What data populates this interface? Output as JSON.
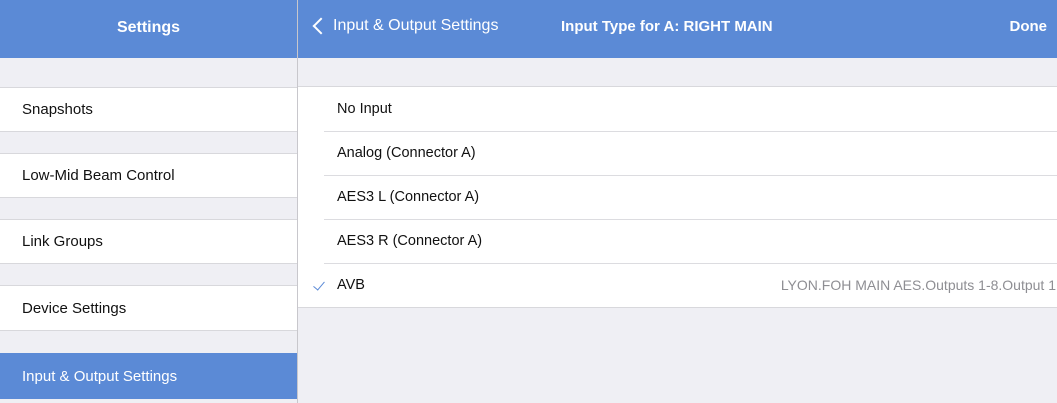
{
  "sidebar": {
    "title": "Settings",
    "items": [
      {
        "label": "Snapshots",
        "active": false
      },
      {
        "label": "Low-Mid Beam Control",
        "active": false
      },
      {
        "label": "Link Groups",
        "active": false
      },
      {
        "label": "Device Settings",
        "active": false
      },
      {
        "label": "Input & Output Settings",
        "active": true
      }
    ]
  },
  "header": {
    "back_label": "Input & Output Settings",
    "title": "Input Type for A: RIGHT MAIN",
    "done_label": "Done"
  },
  "options": [
    {
      "label": "No Input",
      "selected": false,
      "detail": ""
    },
    {
      "label": "Analog (Connector A)",
      "selected": false,
      "detail": ""
    },
    {
      "label": "AES3 L (Connector A)",
      "selected": false,
      "detail": ""
    },
    {
      "label": "AES3 R (Connector A)",
      "selected": false,
      "detail": ""
    },
    {
      "label": "AVB",
      "selected": true,
      "detail": "LYON.FOH MAIN AES.Outputs 1-8.Output 1"
    }
  ],
  "colors": {
    "accent": "#5b8ad6",
    "background": "#efeff4",
    "cell": "#ffffff",
    "detail_text": "#8e8e93"
  }
}
